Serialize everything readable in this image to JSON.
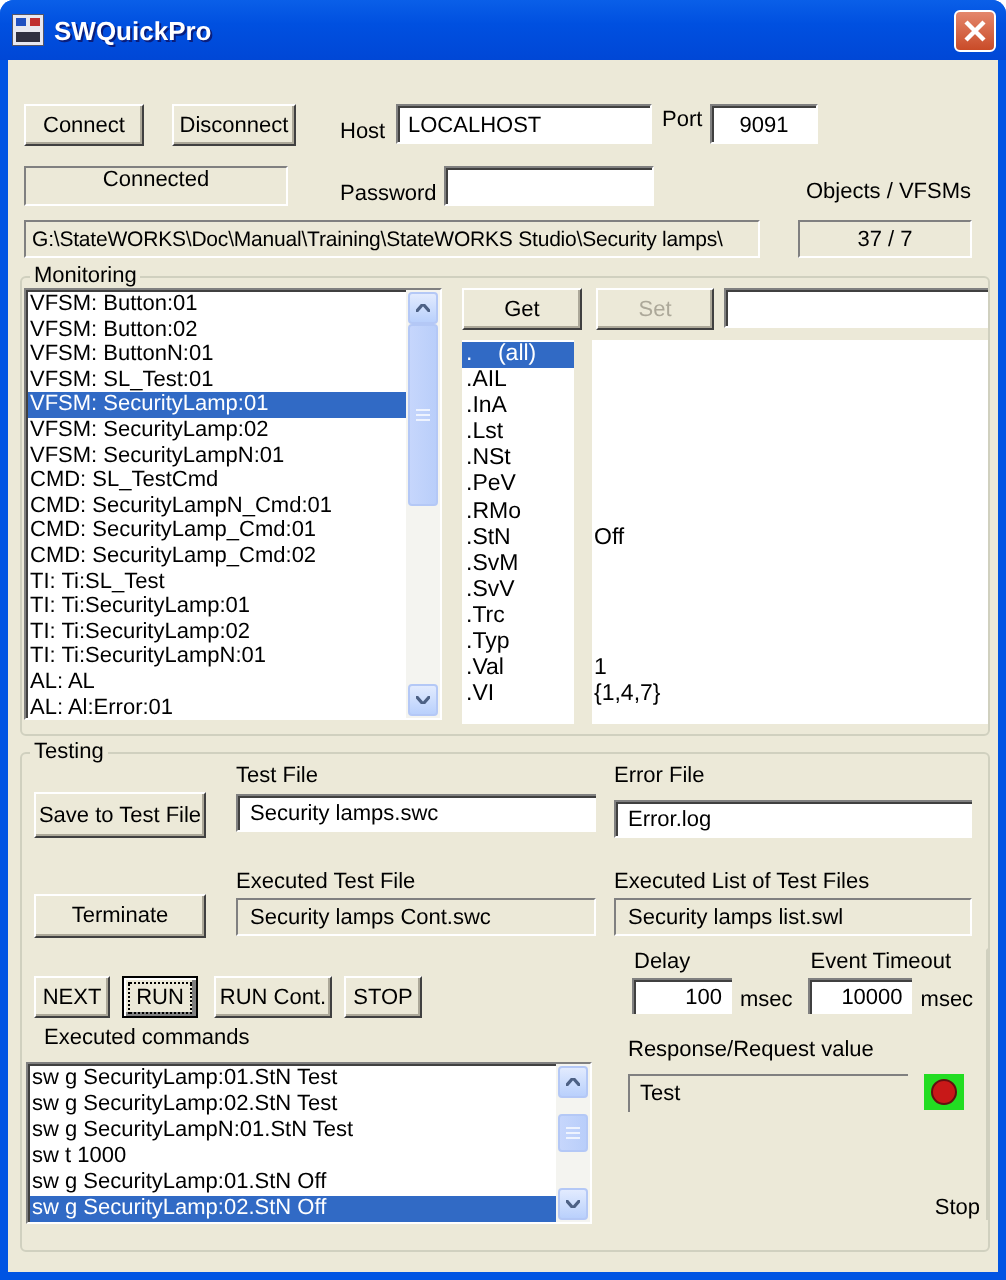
{
  "window": {
    "title": "SWQuickPro"
  },
  "connection": {
    "connect_button": "Connect",
    "disconnect_button": "Disconnect",
    "host_label": "Host",
    "host": "LOCALHOST",
    "port_label": "Port",
    "port": "9091",
    "status": "Connected",
    "password_label": "Password",
    "objects_label": "Objects / VFSMs",
    "path": "G:\\StateWORKS\\Doc\\Manual\\Training\\StateWORKS Studio\\Security lamps\\",
    "objects_count": "37 / 7"
  },
  "monitoring": {
    "title": "Monitoring",
    "objects": [
      {
        "label": "VFSM: Button:01",
        "selected": false
      },
      {
        "label": "VFSM: Button:02",
        "selected": false
      },
      {
        "label": "VFSM: ButtonN:01",
        "selected": false
      },
      {
        "label": "VFSM: SL_Test:01",
        "selected": false
      },
      {
        "label": "VFSM: SecurityLamp:01",
        "selected": true
      },
      {
        "label": "VFSM: SecurityLamp:02",
        "selected": false
      },
      {
        "label": "VFSM: SecurityLampN:01",
        "selected": false
      },
      {
        "label": "CMD: SL_TestCmd",
        "selected": false
      },
      {
        "label": "CMD: SecurityLampN_Cmd:01",
        "selected": false
      },
      {
        "label": "CMD: SecurityLamp_Cmd:01",
        "selected": false
      },
      {
        "label": "CMD: SecurityLamp_Cmd:02",
        "selected": false
      },
      {
        "label": "TI: Ti:SL_Test",
        "selected": false
      },
      {
        "label": "TI: Ti:SecurityLamp:01",
        "selected": false
      },
      {
        "label": "TI: Ti:SecurityLamp:02",
        "selected": false
      },
      {
        "label": "TI: Ti:SecurityLampN:01",
        "selected": false
      },
      {
        "label": "AL: AL",
        "selected": false
      },
      {
        "label": "AL: Al:Error:01",
        "selected": false
      }
    ],
    "get_button": {
      "label": "Get",
      "disabled": false
    },
    "set_button": {
      "label": "Set",
      "disabled": true
    },
    "attributes": [
      {
        "name": ".    (all)",
        "selected": true
      },
      {
        "name": ".AIL",
        "selected": false
      },
      {
        "name": ".InA",
        "selected": false
      },
      {
        "name": ".Lst",
        "selected": false
      },
      {
        "name": ".NSt",
        "selected": false
      },
      {
        "name": ".PeV",
        "selected": false
      },
      {
        "name": ".RMo",
        "selected": false
      },
      {
        "name": ".StN",
        "selected": false,
        "value": "Off"
      },
      {
        "name": ".SvM",
        "selected": false
      },
      {
        "name": ".SvV",
        "selected": false
      },
      {
        "name": ".Trc",
        "selected": false
      },
      {
        "name": ".Typ",
        "selected": false
      },
      {
        "name": ".Val",
        "selected": false,
        "value": "1"
      },
      {
        "name": ".VI",
        "selected": false,
        "value": "{1,4,7}"
      }
    ]
  },
  "testing": {
    "title": "Testing",
    "save_button": "Save to Test File",
    "test_file_label": "Test File",
    "test_file": "Security lamps.swc",
    "error_file_label": "Error File",
    "error_file": "Error.log",
    "terminate_button": "Terminate",
    "executed_test_file_label": "Executed Test File",
    "executed_test_file": "Security lamps Cont.swc",
    "executed_list_label": "Executed List of Test Files",
    "executed_list": "Security lamps list.swl",
    "buttons": [
      {
        "label": "NEXT",
        "focused": false
      },
      {
        "label": "RUN",
        "focused": true
      },
      {
        "label": "RUN Cont.",
        "focused": false
      },
      {
        "label": "STOP",
        "focused": false
      }
    ],
    "delay_label": "Delay",
    "delay": "100",
    "delay_unit": "msec",
    "timeout_label": "Event Timeout",
    "timeout": "10000",
    "timeout_unit": "msec",
    "commands_label": "Executed commands",
    "commands": [
      {
        "text": "sw g SecurityLamp:01.StN Test",
        "selected": false
      },
      {
        "text": "sw g SecurityLamp:02.StN Test",
        "selected": false
      },
      {
        "text": "sw g SecurityLampN:01.StN Test",
        "selected": false
      },
      {
        "text": "sw t 1000",
        "selected": false
      },
      {
        "text": "sw g SecurityLamp:01.StN Off",
        "selected": false
      },
      {
        "text": "sw g SecurityLamp:02.StN Off",
        "selected": true
      }
    ],
    "response_label": "Response/Request value",
    "response": "Test",
    "stop_label": "Stop"
  }
}
